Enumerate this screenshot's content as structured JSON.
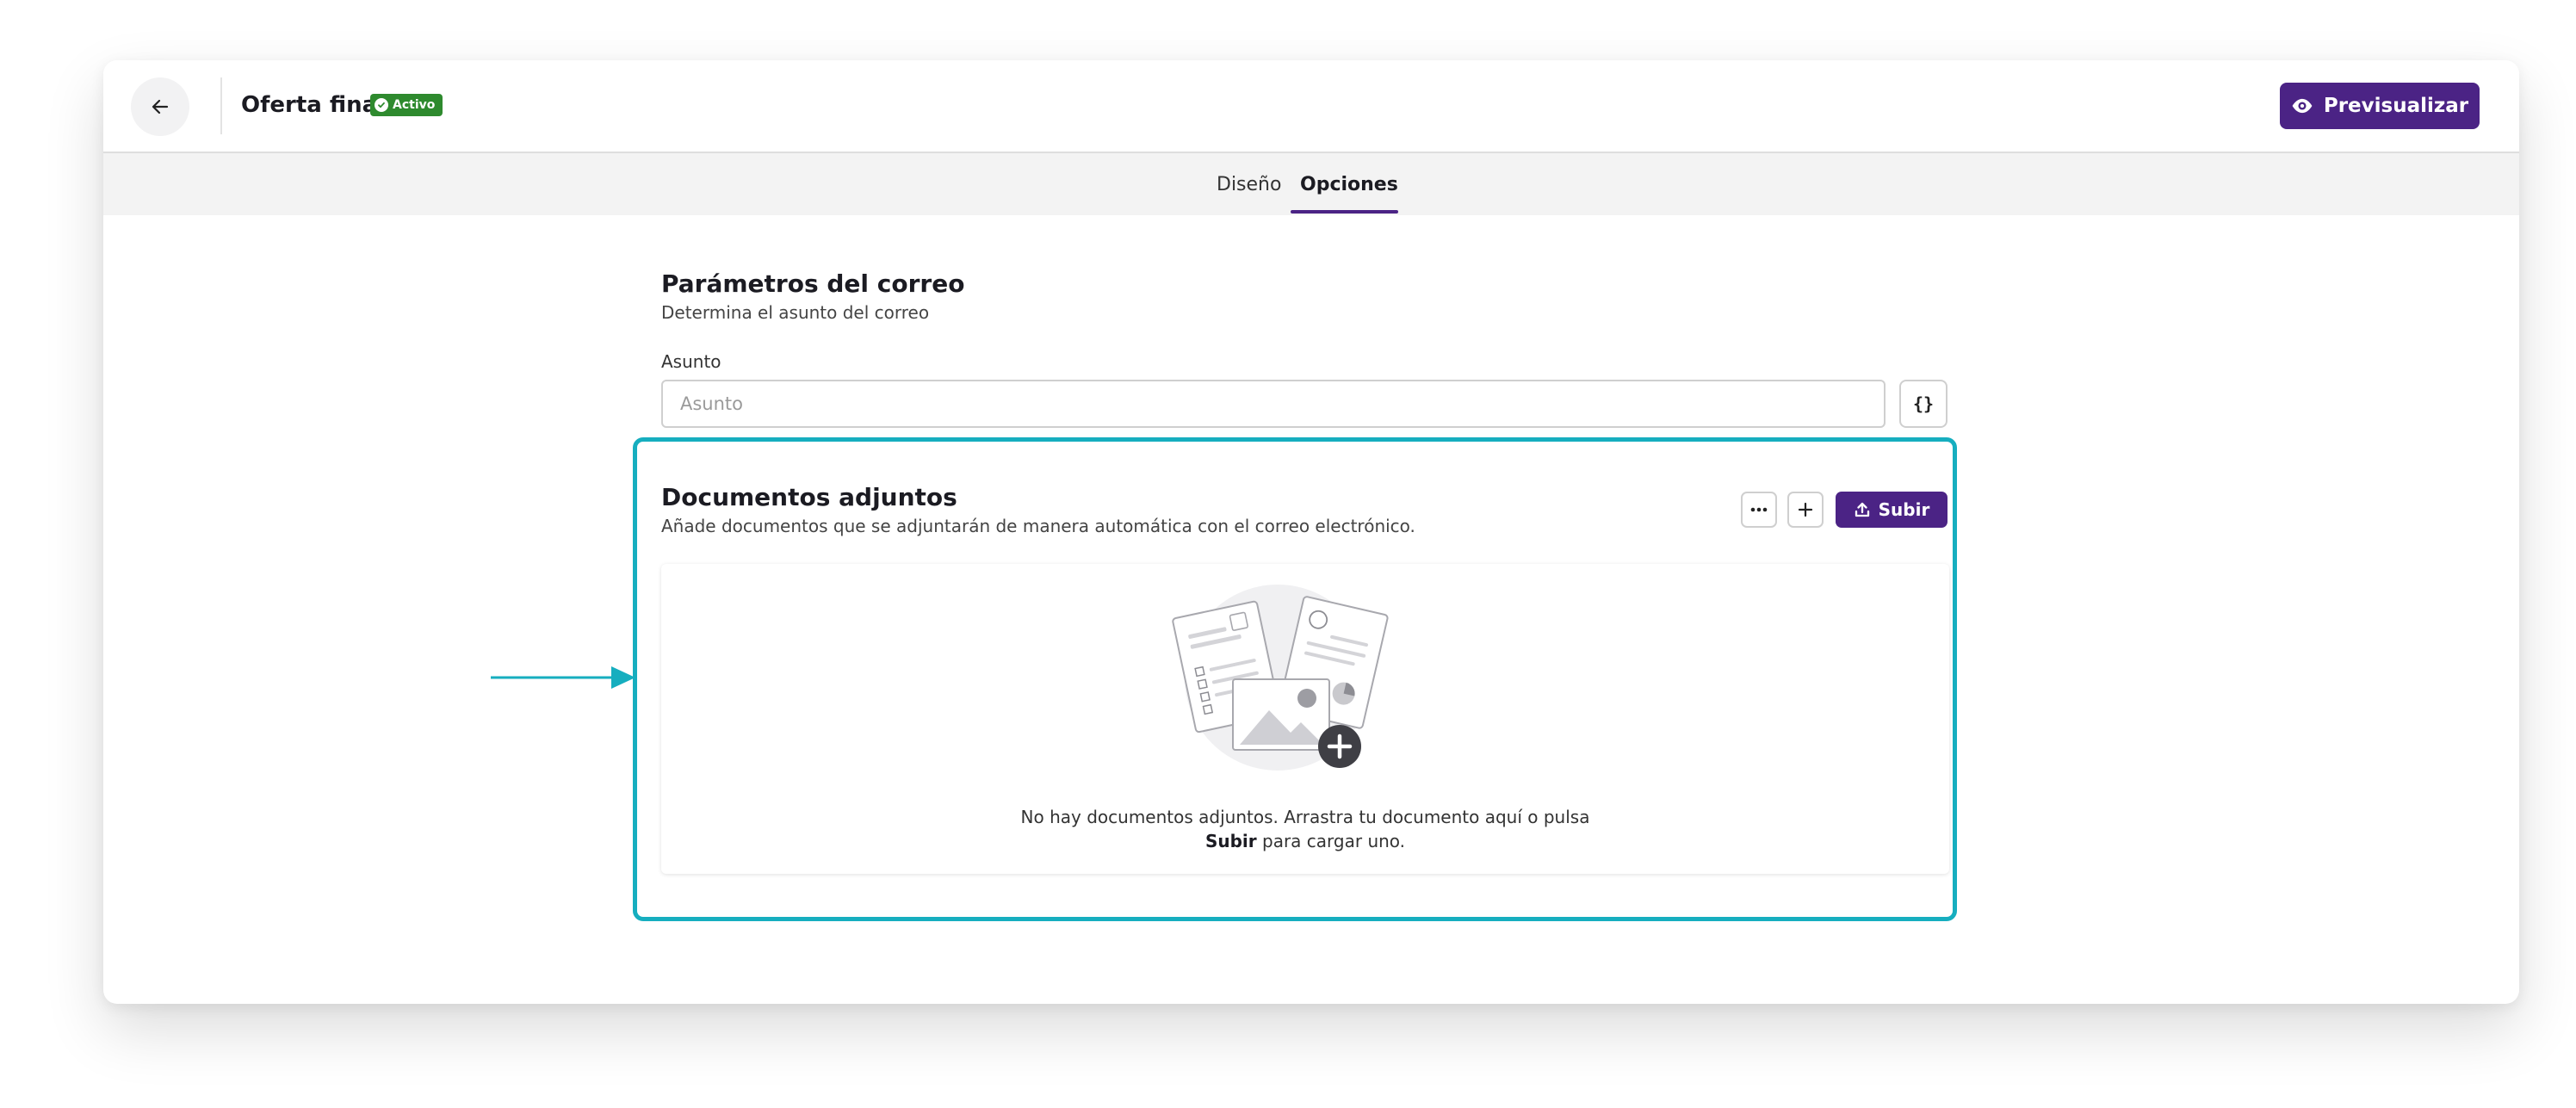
{
  "header": {
    "title": "Oferta final",
    "status_badge": "Activo",
    "preview_label": "Previsualizar"
  },
  "tabs": [
    {
      "label": "Diseño",
      "active": false
    },
    {
      "label": "Opciones",
      "active": true
    }
  ],
  "email_params": {
    "title": "Parámetros del correo",
    "description": "Determina el asunto del correo",
    "subject_label": "Asunto",
    "subject_placeholder": "Asunto",
    "subject_value": "",
    "variables_button": "{}"
  },
  "attachments": {
    "title": "Documentos adjuntos",
    "description": "Añade documentos que se adjuntarán de manera automática con el correo electrónico.",
    "upload_label": "Subir",
    "empty_line1": "No hay documentos adjuntos. Arrastra tu documento aquí o pulsa",
    "empty_bold": "Subir",
    "empty_line2": "para cargar uno."
  },
  "colors": {
    "primary": "#4b2385",
    "badge_green": "#2e8a2e",
    "annotation_teal": "#16aebf",
    "tabs_bg": "#f3f3f3"
  },
  "icons": [
    "arrow-left-icon",
    "check-circle-icon",
    "eye-icon",
    "braces-icon",
    "more-dots-icon",
    "plus-icon",
    "upload-icon",
    "documents-illustration"
  ]
}
